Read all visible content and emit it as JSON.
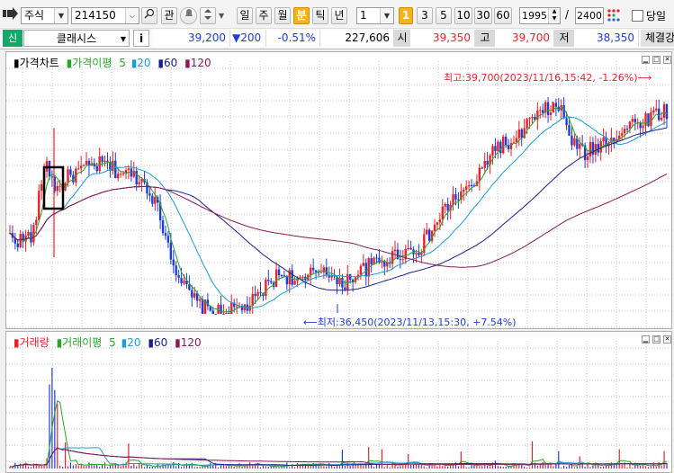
{
  "toolbar": {
    "market": "주식",
    "code": "214150",
    "btn_watch": "관",
    "periods": [
      "일",
      "주",
      "월",
      "분",
      "틱",
      "년"
    ],
    "selected_period": "분",
    "interval_value": "1",
    "quick_intervals": [
      "1",
      "3",
      "5",
      "10",
      "30",
      "60"
    ],
    "selected_quick": "1",
    "count_value": "1995",
    "count_sep": "/",
    "count_total": "2400",
    "today_label": "당일"
  },
  "quote": {
    "sin": "신",
    "name": "클래시스",
    "info": "i",
    "price": "39,200",
    "change": "▼200",
    "pct": "-0.51%",
    "volume": "227,606",
    "open_label": "시",
    "open": "39,350",
    "high_label": "고",
    "high": "39,700",
    "low_label": "저",
    "low": "38,350",
    "tab_label": "체결강"
  },
  "price_panel": {
    "legend": {
      "title": "가격차트",
      "ma_label": "가격이평",
      "ma": [
        "5",
        "20",
        "60",
        "120"
      ]
    },
    "max_annotation": "최고:39,700(2023/11/16,15:42, -1.26%)",
    "min_annotation": "최저:36,450(2023/11/13,15:30, +7.54%)"
  },
  "volume_panel": {
    "legend": {
      "title": "거래량",
      "ma_label": "거래이평",
      "ma": [
        "5",
        "20",
        "60",
        "120"
      ]
    }
  },
  "colors": {
    "up": "#e8222d",
    "down": "#1f3dd6",
    "ma5": "#2aa52a",
    "ma20": "#1f9bd6",
    "ma60": "#1a1f8c",
    "ma120": "#8a1a55",
    "accent": "#f4b31c"
  },
  "chart_data": {
    "type": "candlestick",
    "price_range": [
      36450,
      39700
    ],
    "max": {
      "value": 39700,
      "time": "2023/11/16 15:42"
    },
    "min": {
      "value": 36450,
      "time": "2023/11/13 15:30"
    },
    "close_trend": [
      37600,
      37550,
      37650,
      38750,
      38300,
      38500,
      38600,
      38650,
      38700,
      38600,
      38550,
      38500,
      38300,
      37800,
      37200,
      36800,
      36600,
      36500,
      36450,
      36500,
      36550,
      36650,
      36900,
      37050,
      37000,
      36900,
      37100,
      37150,
      36850,
      37000,
      37100,
      37200,
      37250,
      37350,
      37400,
      37450,
      37700,
      38000,
      38200,
      38300,
      38500,
      38900,
      39000,
      38950,
      39300,
      39400,
      39550,
      39500,
      39000,
      38850,
      38950,
      39100,
      39150,
      39300,
      39350,
      39450,
      39500
    ]
  }
}
